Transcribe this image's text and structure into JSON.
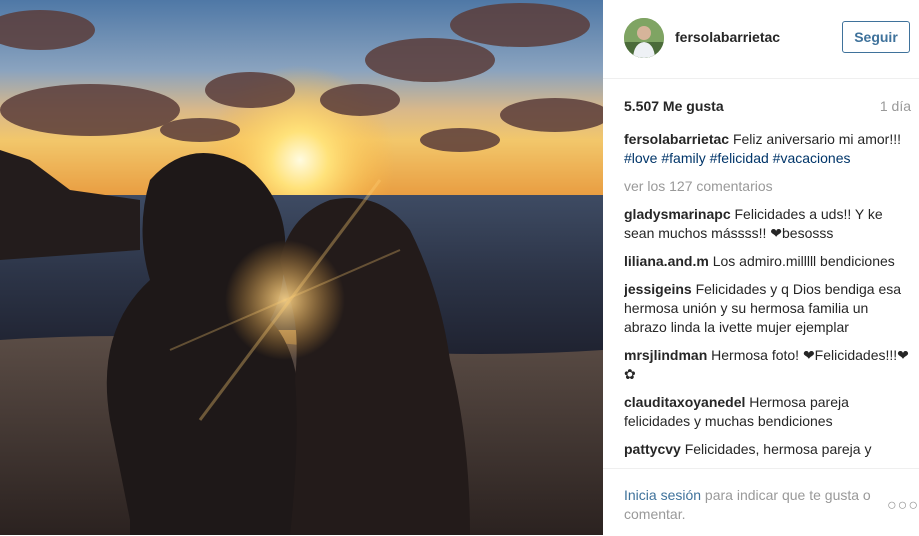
{
  "post": {
    "username": "fersolabarrietac",
    "follow_label": "Seguir",
    "likes": "5.507 Me gusta",
    "age": "1 día",
    "caption_text": "Feliz aniversario mi amor!!!",
    "caption_tags": [
      "#love",
      "#family",
      "#felicidad",
      "#vacaciones"
    ],
    "view_all": "ver los 127 comentarios"
  },
  "comments": [
    {
      "user": "gladysmarinapc",
      "text": "Felicidades a uds!! Y ke sean muchos mássss!! ❤besosss"
    },
    {
      "user": "liliana.and.m",
      "text": "Los admiro.milllll bendiciones"
    },
    {
      "user": "jessigeins",
      "text": "Felicidades y q Dios bendiga esa hermosa unión y su hermosa familia un abrazo linda la ivette mujer ejemplar"
    },
    {
      "user": "mrsjlindman",
      "text": "Hermosa foto! ❤Felicidades!!!❤✿"
    },
    {
      "user": "clauditaxoyanedel",
      "text": "Hermosa pareja felicidades y muchas bendiciones"
    },
    {
      "user": "pattycvy",
      "text": "Felicidades, hermosa pareja y"
    }
  ],
  "footer": {
    "login_link": "Inicia sesión",
    "rest": " para indicar que te gusta o comentar.",
    "more_label": "○○○"
  }
}
